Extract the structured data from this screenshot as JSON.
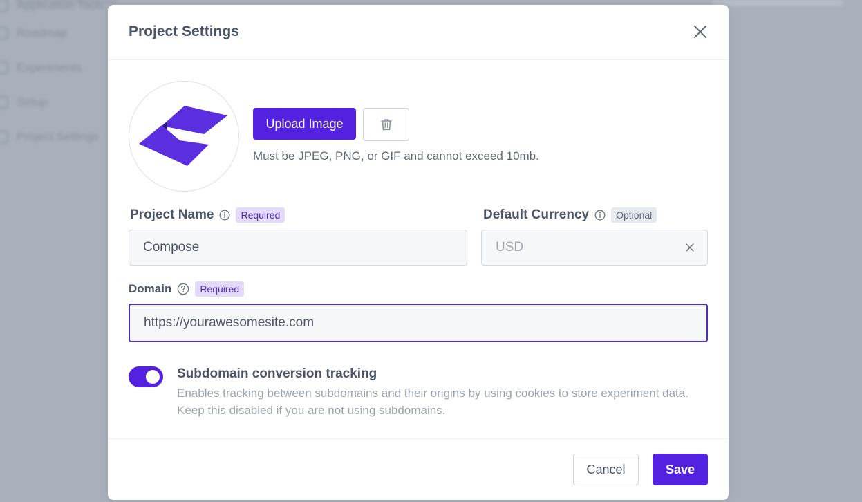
{
  "background_nav": {
    "items": [
      {
        "label": "Application Tools"
      },
      {
        "label": "Roadmap"
      },
      {
        "label": "Experiments"
      },
      {
        "label": "Setup"
      },
      {
        "label": "Project Settings"
      }
    ]
  },
  "modal": {
    "title": "Project Settings",
    "close_icon": "close-icon"
  },
  "image_upload": {
    "upload_label": "Upload Image",
    "delete_icon": "trash-icon",
    "hint": "Must be JPEG, PNG, or GIF and cannot exceed 10mb."
  },
  "fields": {
    "project_name": {
      "label": "Project Name",
      "badge": "Required",
      "value": "Compose"
    },
    "default_currency": {
      "label": "Default Currency",
      "badge": "Optional",
      "value": "USD"
    },
    "domain": {
      "label": "Domain",
      "badge": "Required",
      "value": "https://yourawesomesite.com"
    }
  },
  "subdomain_tracking": {
    "title": "Subdomain conversion tracking",
    "description": "Enables tracking between subdomains and their origins by using cookies to store experiment data. Keep this disabled if you are not using subdomains.",
    "enabled": true
  },
  "footer": {
    "cancel_label": "Cancel",
    "save_label": "Save"
  },
  "colors": {
    "accent": "#5222e0",
    "required_badge_bg": "#e4dafc",
    "optional_badge_bg": "#e6e9ee",
    "overlay": "#a9b0bc"
  }
}
